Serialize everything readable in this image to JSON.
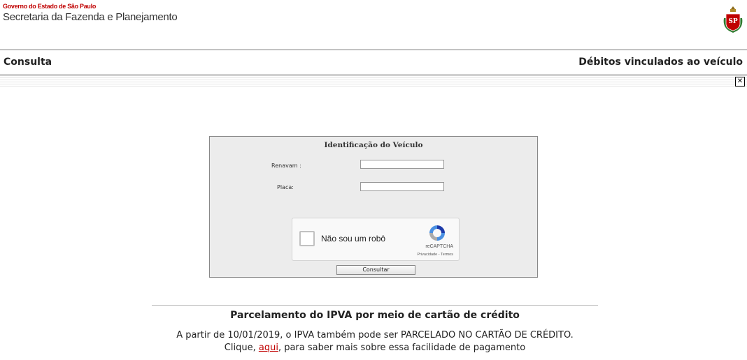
{
  "header": {
    "gov_line": "Governo do Estado de São Paulo",
    "secretaria": "Secretaria da Fazenda e Planejamento",
    "logo_text": "SP"
  },
  "titlebar": {
    "left": "Consulta",
    "right": "Débitos vinculados ao veículo",
    "close_glyph": "✕"
  },
  "form": {
    "title": "Identificação do Veículo",
    "renavam_label": "Renavam :",
    "renavam_value": "",
    "placa_label": "Placa:",
    "placa_value": "",
    "captcha": {
      "label": "Não sou um robô",
      "brand": "reCAPTCHA",
      "links": "Privacidade - Termos"
    },
    "submit_label": "Consultar"
  },
  "promo": {
    "title": "Parcelamento do IPVA por meio de cartão de crédito",
    "line1": "A partir de 10/01/2019, o IPVA também pode ser PARCELADO NO CARTÃO DE CRÉDITO.",
    "line2_prefix": "Clique",
    "line2_link": "aqui",
    "line2_suffix": "para saber mais sobre essa facilidade de pagamento"
  },
  "colors": {
    "gov_red": "#c00000",
    "panel_bg": "#ececec"
  }
}
